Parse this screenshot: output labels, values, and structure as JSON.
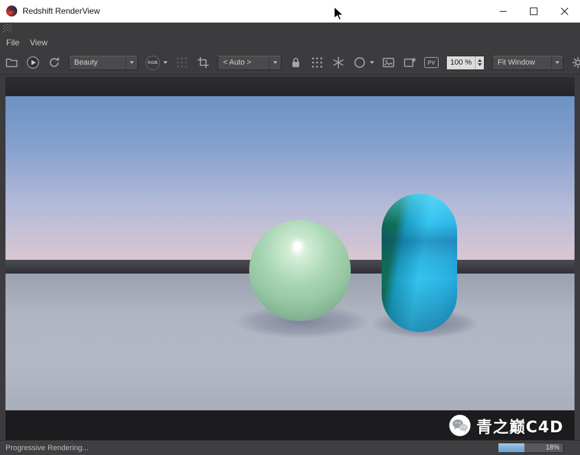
{
  "window": {
    "title": "Redshift RenderView",
    "controls": [
      "minimize",
      "maximize",
      "close"
    ]
  },
  "menubar": {
    "file": "File",
    "view": "View"
  },
  "toolbar": {
    "aov_value": "Beauty",
    "rgb_label": "RGB",
    "snapshot_value": "< Auto >",
    "pv_label": "PV",
    "zoom_value": "100 %",
    "fit_value": "Fit Window",
    "icons": [
      "save-snapshot",
      "start-render",
      "restart-render",
      "aov-dropdown",
      "display-mode-rgb",
      "bucket-grid",
      "region-crop",
      "snapshot-compare-dropdown",
      "lock",
      "grid",
      "freeze-tessellation-snowflake",
      "ring-options",
      "copy-image",
      "add-image",
      "picture-viewer",
      "zoom-spinbox",
      "fit-window-dropdown",
      "settings-gear"
    ]
  },
  "statusbar": {
    "text": "Progressive Rendering...",
    "progress_label": "18%",
    "progress_fill_percent": 40
  },
  "watermark": {
    "icon": "wechat",
    "text": "青之巅C4D"
  },
  "render": {
    "objects": [
      "mint-green-sphere",
      "blue-green-capsule"
    ],
    "colors": {
      "sky_top": "#6d92c4",
      "sky_horizon": "#d9c7d2",
      "horizon_band": "#3e4046",
      "floor": "#aeb4c0",
      "sphere": "#a9d6b4",
      "capsule_blue": "#35c3ef",
      "capsule_green": "#11624f"
    }
  }
}
